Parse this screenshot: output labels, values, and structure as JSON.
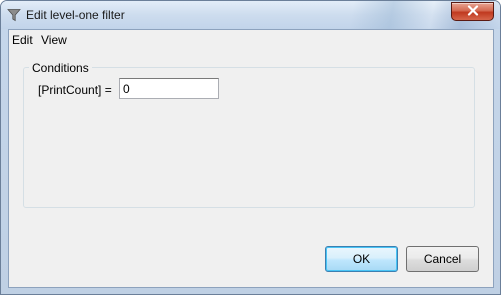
{
  "window": {
    "title": "Edit level-one filter"
  },
  "menu": {
    "items": [
      {
        "label": "Edit"
      },
      {
        "label": "View"
      }
    ]
  },
  "conditions": {
    "group_label": "Conditions",
    "field_label": "[PrintCount] =",
    "field_value": "0"
  },
  "buttons": {
    "ok_label": "OK",
    "cancel_label": "Cancel"
  },
  "colors": {
    "default_button_border": "#3c7fb1",
    "close_button": "#c0391f"
  }
}
